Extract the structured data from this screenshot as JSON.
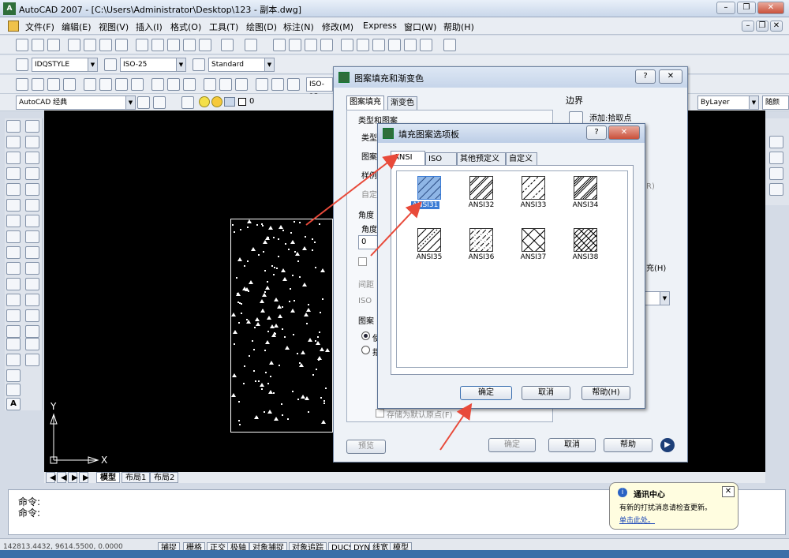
{
  "window": {
    "title": "AutoCAD 2007 - [C:\\Users\\Administrator\\Desktop\\123 - 副本.dwg]",
    "app_icon": "autocad-icon"
  },
  "menu": [
    "文件(F)",
    "编辑(E)",
    "视图(V)",
    "插入(I)",
    "格式(O)",
    "工具(T)",
    "绘图(D)",
    "标注(N)",
    "修改(M)",
    "Express",
    "窗口(W)",
    "帮助(H)"
  ],
  "toolbar2": {
    "style_combo": "IDQSTYLE",
    "dim_combo": "ISO-25",
    "table_combo": "Standard"
  },
  "toolbar3": {
    "dim_style_combo": "ISO-25"
  },
  "toolbar4": {
    "workspace_combo": "AutoCAD 经典",
    "layer_value": "0",
    "bylayer_combo": "ByLayer",
    "color_combo": "随颜"
  },
  "layout_tabs": [
    "模型",
    "布局1",
    "布局2"
  ],
  "ucs": {
    "y_label": "Y",
    "x_label": "X"
  },
  "command": {
    "line1": "命令:",
    "line2": "命令:"
  },
  "status": {
    "coords": "142813.4432, 9614.5500, 0.0000",
    "buttons": [
      "捕捉",
      "栅格",
      "正交",
      "极轴",
      "对象捕捉",
      "对象追踪",
      "DUCS",
      "DYN",
      "线宽",
      "模型"
    ]
  },
  "hatch_dialog": {
    "title": "图案填充和渐变色",
    "tab_hatch": "图案填充",
    "tab_gradient": "渐变色",
    "section_type": "类型和图案",
    "type_label": "类型",
    "pattern_label": "图案",
    "sample_label": "样例",
    "custom_label": "自定",
    "angle_section": "角度",
    "angle_label": "角度",
    "angle_value": "0",
    "spacing_label": "间距",
    "iso_label": "ISO",
    "origin_section": "图案",
    "origin_use": "使",
    "origin_specify": "指",
    "store_default": "存储为默认原点(F)",
    "boundary_title": "边界",
    "add_pick": "添加:拾取点",
    "r_text": "R)",
    "fill_text": "充(H)",
    "preview_btn": "预览",
    "ok_btn": "确定",
    "cancel_btn": "取消",
    "help_btn": "帮助",
    "help_q": "?",
    "close_x": "✕"
  },
  "palette_dialog": {
    "title": "填充图案选项板",
    "tabs": [
      "ANSI",
      "ISO",
      "其他预定义",
      "自定义"
    ],
    "patterns": [
      "ANSI31",
      "ANSI32",
      "ANSI33",
      "ANSI34",
      "ANSI35",
      "ANSI36",
      "ANSI37",
      "ANSI38"
    ],
    "selected": "ANSI31",
    "ok_btn": "确定",
    "cancel_btn": "取消",
    "help_btn": "帮助(H)",
    "help_q": "?",
    "close_x": "✕"
  },
  "balloon": {
    "title": "通讯中心",
    "text": "有新的打扰消息请检查更新。",
    "link": "单击此处。",
    "close_x": "✕"
  },
  "colors": {
    "canvas": "#000000",
    "arrow": "#e84a3a",
    "selection": "#3a7bd5"
  }
}
